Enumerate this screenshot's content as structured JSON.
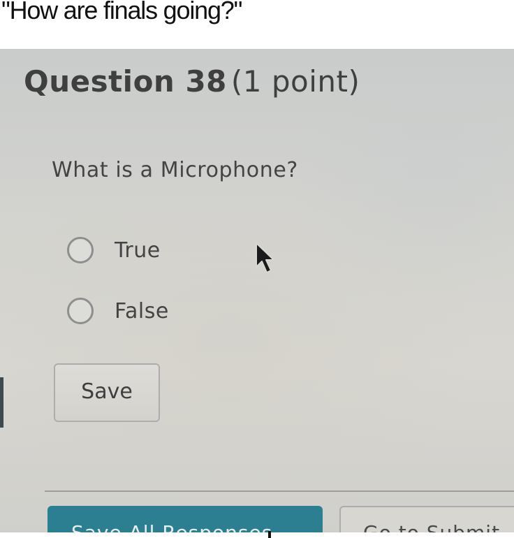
{
  "caption": {
    "text": "\"How are finals going?\""
  },
  "quiz": {
    "question_number": "Question 38",
    "question_points": "(1 point)",
    "question_text": "What is a Microphone?",
    "options": [
      {
        "label": "True",
        "selected": false
      },
      {
        "label": "False",
        "selected": false
      }
    ],
    "save_label": "Save"
  },
  "footer": {
    "save_all_label": "Save All Responses",
    "submit_label": "Go to Submit"
  },
  "colors": {
    "screen_background": "#d3d3cf",
    "title_text": "#3f3f3f",
    "body_text": "#444444",
    "primary_button": "#2c7e91",
    "radio_border": "#8e8e8c"
  },
  "icons": {
    "cursor": "mouse-pointer-icon"
  }
}
